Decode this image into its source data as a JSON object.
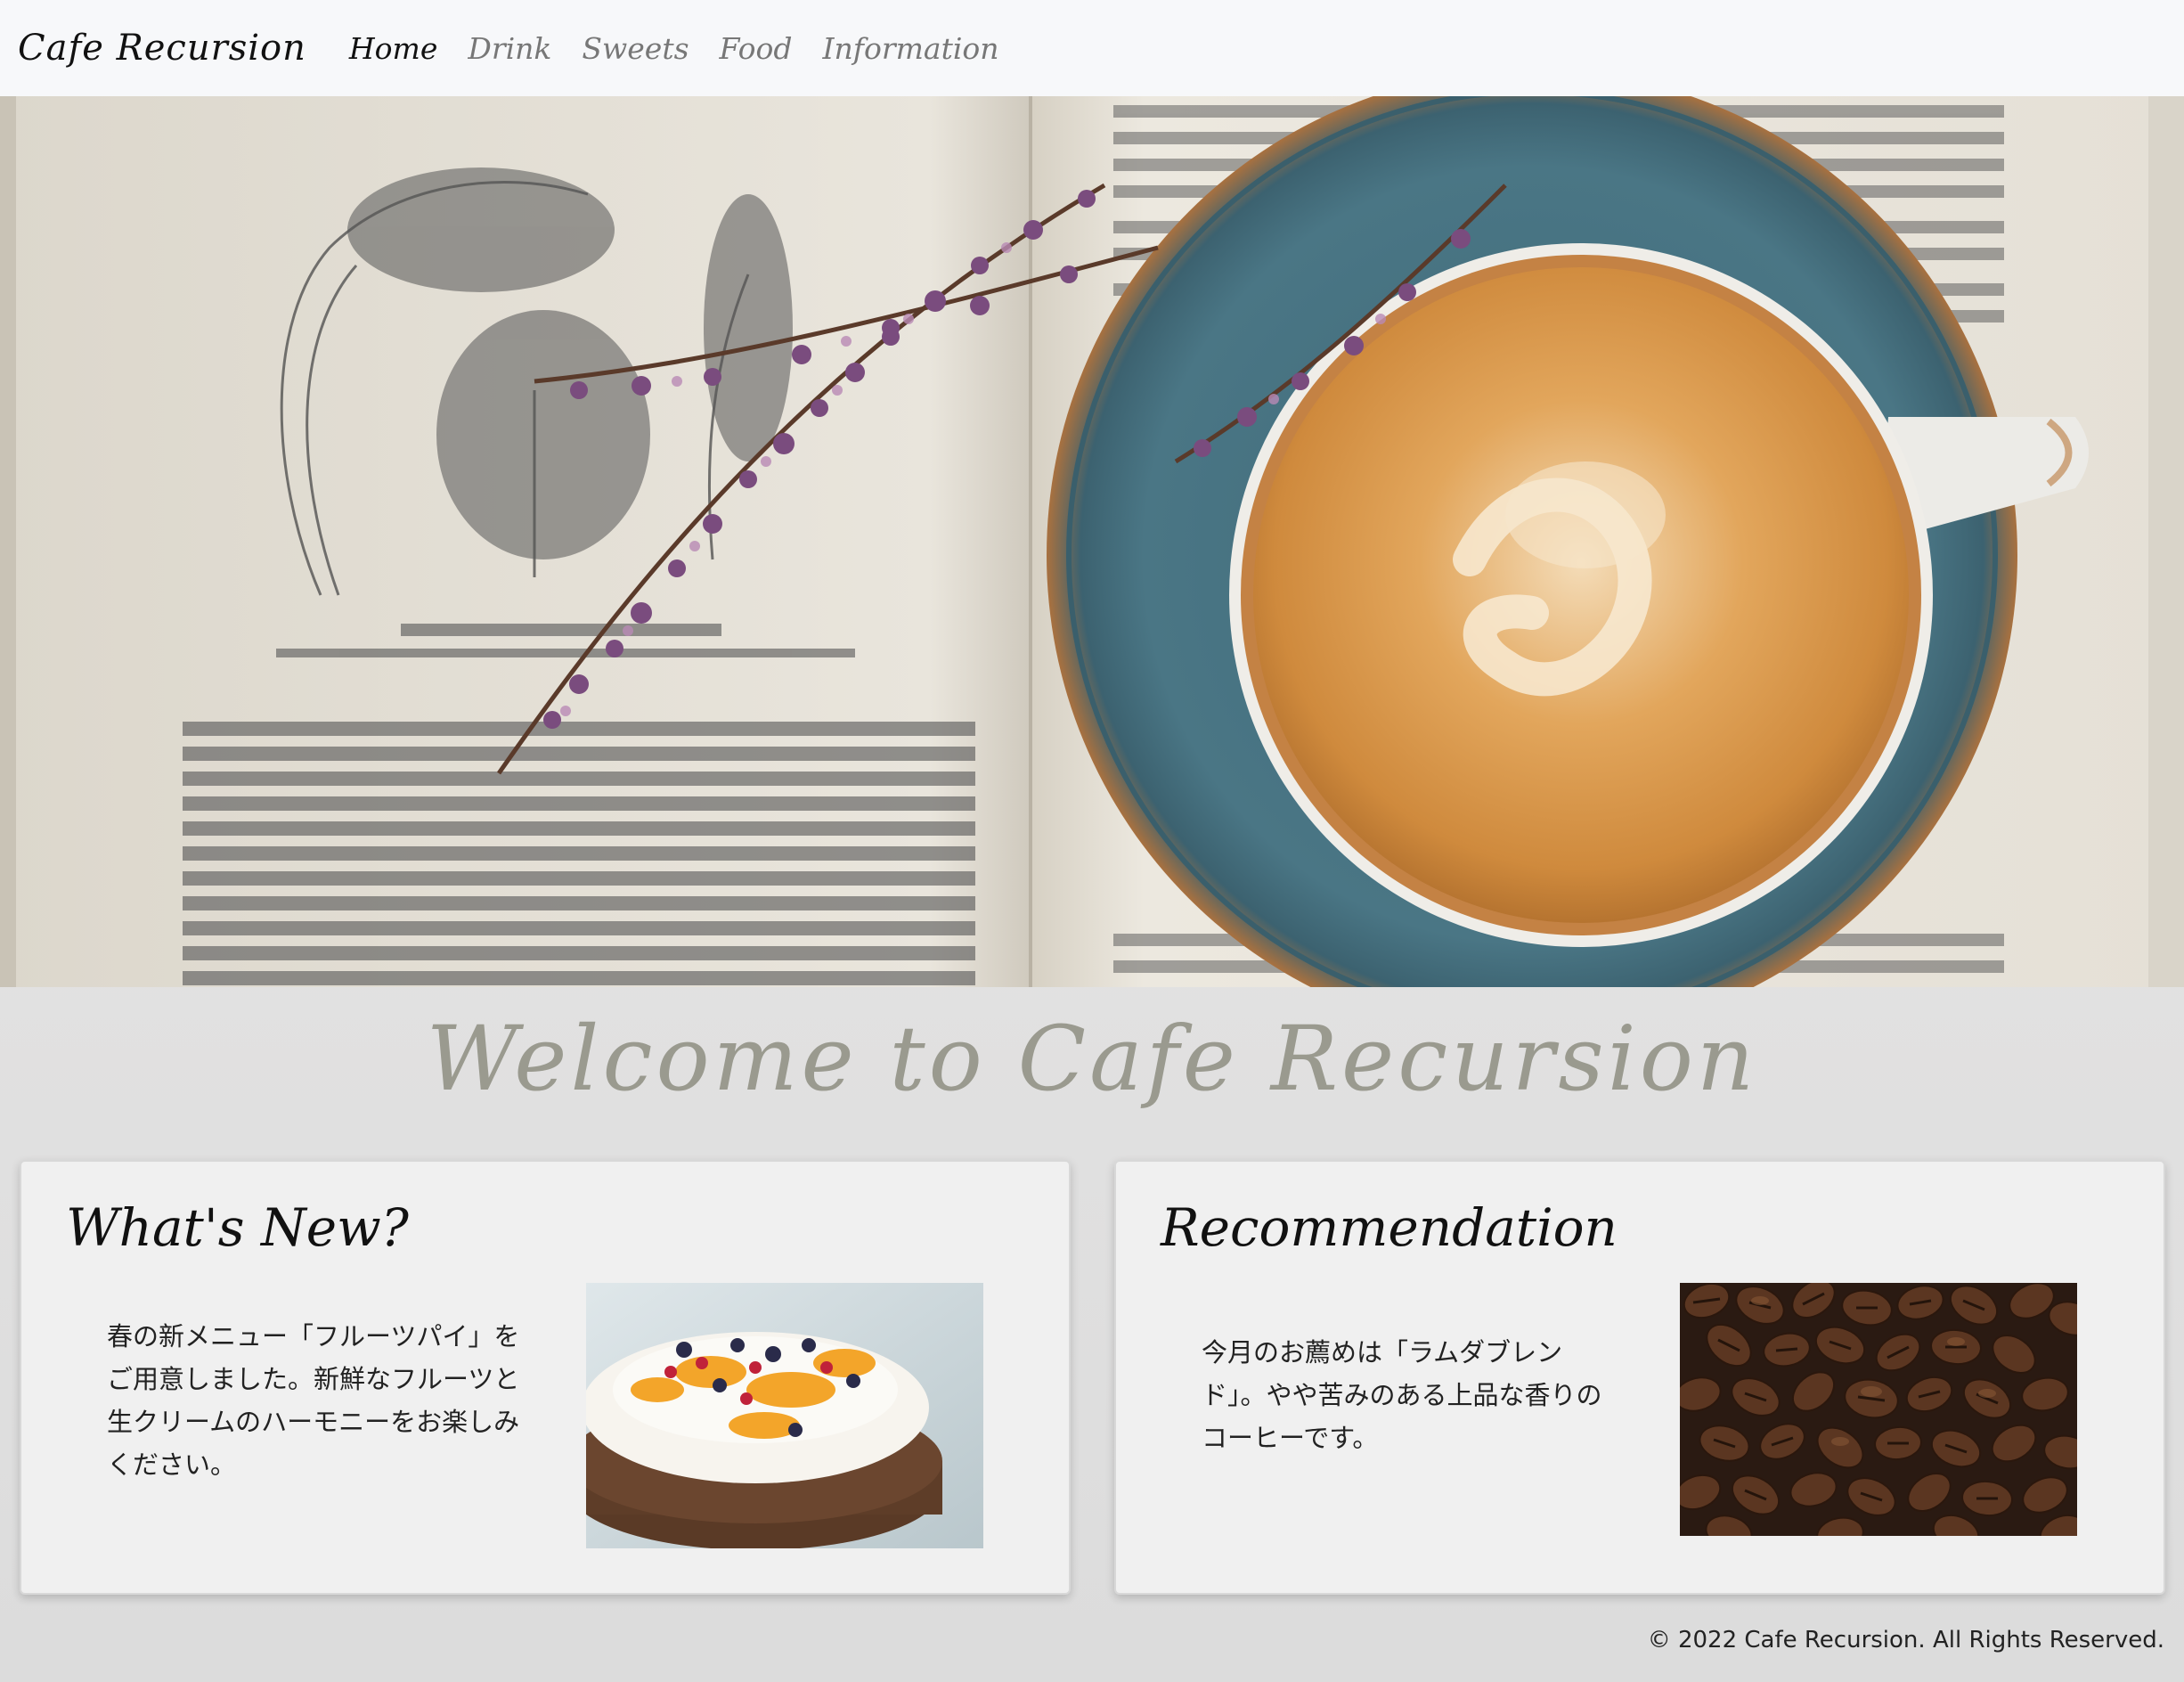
{
  "nav": {
    "brand": "Cafe Recursion",
    "links": [
      "Home",
      "Drink",
      "Sweets",
      "Food",
      "Information"
    ],
    "active": "Home"
  },
  "hero": {
    "image": "open-book-with-coffee-cup-and-heather"
  },
  "welcome": {
    "title": "Welcome to Cafe Recursion"
  },
  "cards": [
    {
      "title": "What's New?",
      "text": "春の新メニュー「フルーツパイ」をご用意しました。新鮮なフルーツと生クリームのハーモニーをお楽しみください。",
      "image": "fruit-cream-pie"
    },
    {
      "title": "Recommendation",
      "text": "今月のお薦めは「ラムダブレンド」。やや苦みのある上品な香りのコーヒーです。",
      "image": "coffee-beans"
    }
  ],
  "footer": {
    "copyright": "© 2022 Cafe Recursion. All Rights Reserved."
  },
  "colors": {
    "navbar_bg": "#f7f8fa",
    "page_bg": "#e4e4e4",
    "welcome_text": "#9a9a8f",
    "card_bg": "#f0f0f0",
    "saucer": "#46707f",
    "crema": "#d89a4c"
  }
}
